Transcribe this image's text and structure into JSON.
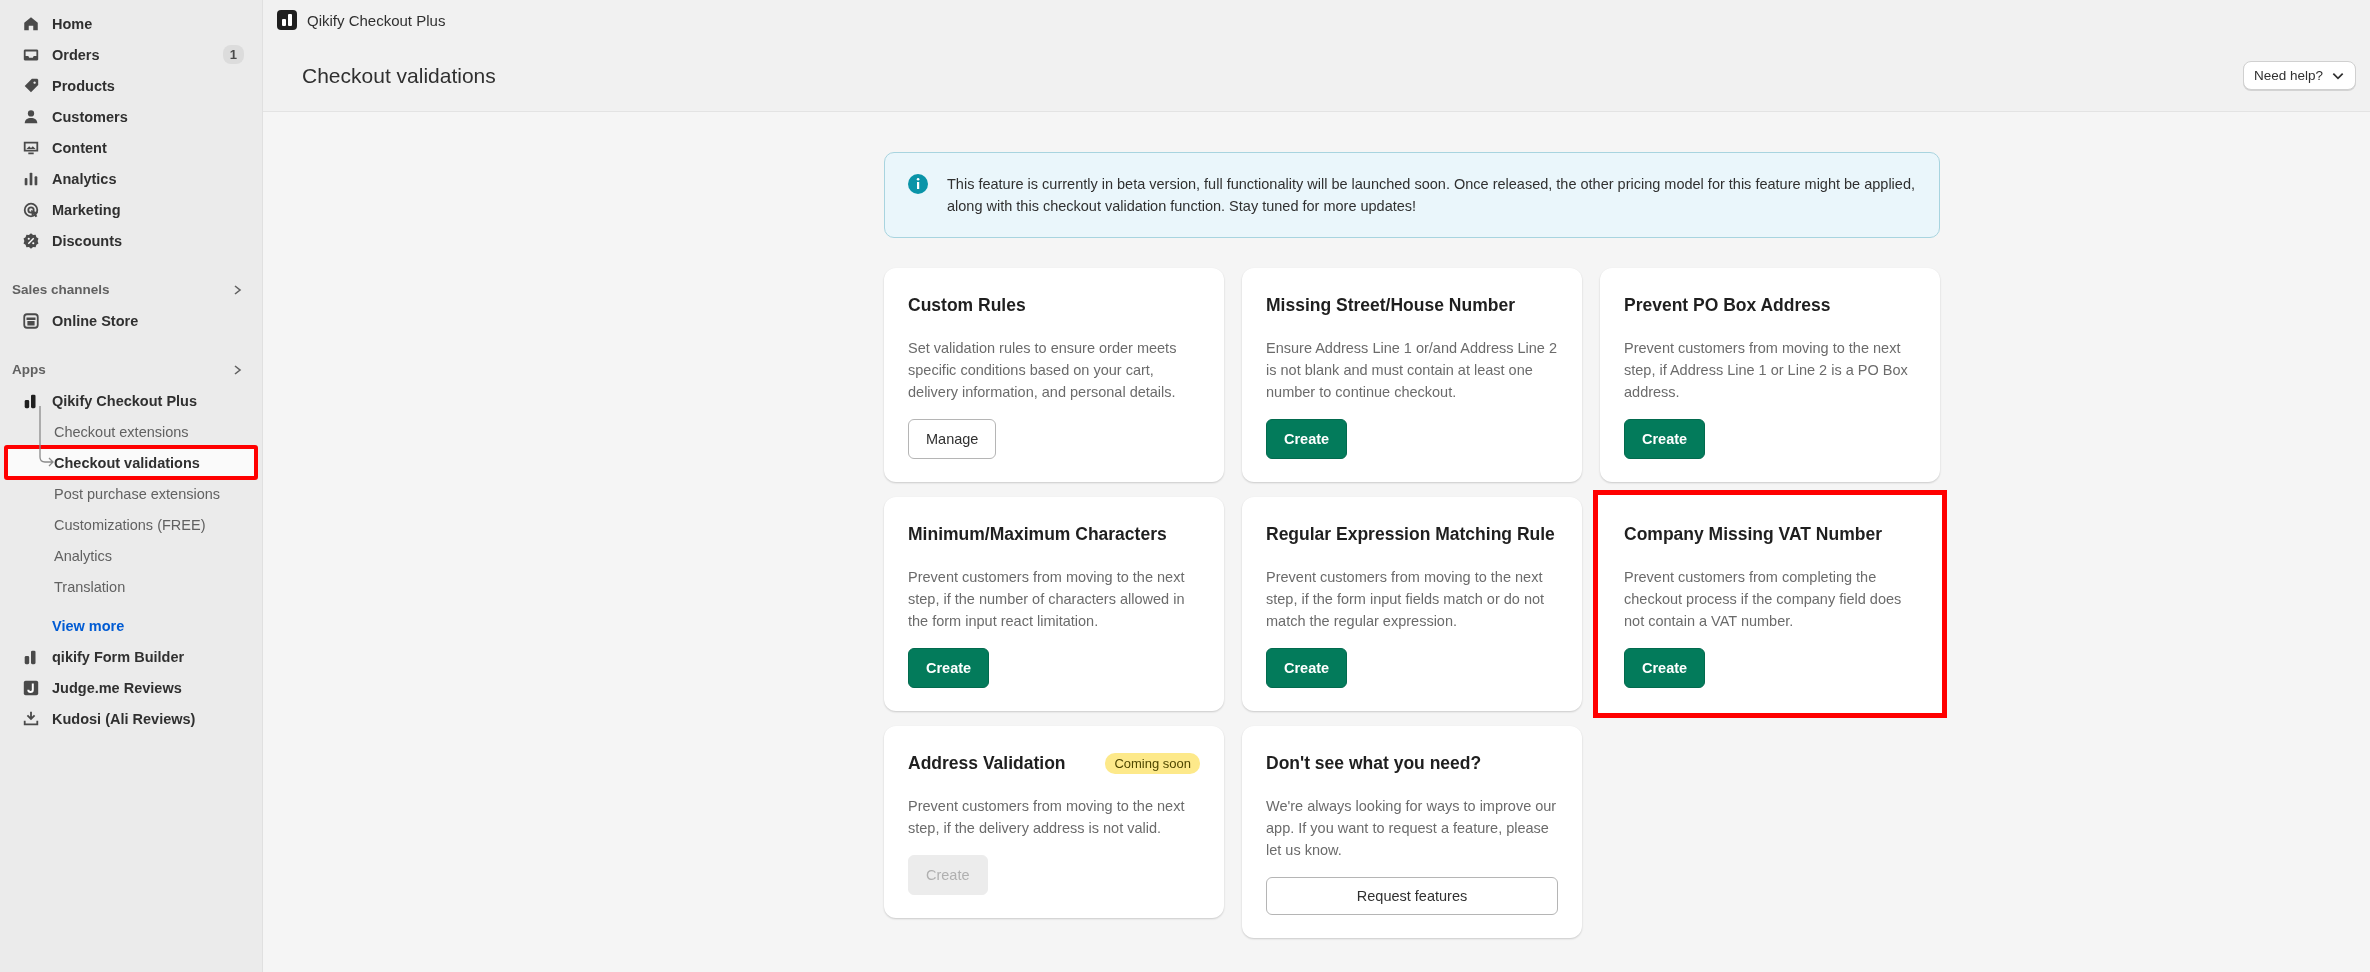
{
  "top_bar": {
    "app_name": "Qikify Checkout Plus"
  },
  "sidebar": {
    "items": [
      {
        "label": "Home"
      },
      {
        "label": "Orders",
        "badge": "1"
      },
      {
        "label": "Products"
      },
      {
        "label": "Customers"
      },
      {
        "label": "Content"
      },
      {
        "label": "Analytics"
      },
      {
        "label": "Marketing"
      },
      {
        "label": "Discounts"
      }
    ],
    "sections": [
      {
        "title": "Sales channels",
        "items": [
          {
            "label": "Online Store"
          }
        ]
      },
      {
        "title": "Apps",
        "items": [
          {
            "label": "Qikify Checkout Plus",
            "children": [
              {
                "label": "Checkout extensions",
                "selected": false,
                "highlighted": false
              },
              {
                "label": "Checkout validations",
                "selected": true,
                "highlighted": true
              },
              {
                "label": "Post purchase extensions",
                "selected": false,
                "highlighted": false
              },
              {
                "label": "Customizations (FREE)",
                "selected": false,
                "highlighted": false
              },
              {
                "label": "Analytics",
                "selected": false,
                "highlighted": false
              },
              {
                "label": "Translation",
                "selected": false,
                "highlighted": false
              }
            ],
            "view_more": "View more"
          },
          {
            "label": "qikify Form Builder"
          },
          {
            "label": "Judge.me Reviews"
          },
          {
            "label": "Kudosi (Ali Reviews)"
          }
        ]
      }
    ]
  },
  "page": {
    "title": "Checkout validations",
    "help_button": "Need help?"
  },
  "banner": {
    "text": "This feature is currently in beta version, full functionality will be launched soon. Once released, the other pricing model for this feature might be applied, along with this checkout validation function. Stay tuned for more updates!"
  },
  "cards": [
    {
      "kind": "rule",
      "title": "Custom Rules",
      "description": "Set validation rules to ensure order meets specific conditions based on your cart, delivery information, and personal details.",
      "button": {
        "label": "Manage",
        "kind": "manage",
        "disabled": false
      },
      "highlighted": false
    },
    {
      "kind": "rule",
      "title": "Missing Street/House Number",
      "description": "Ensure Address Line 1 or/and Address Line 2 is not blank and must contain at least one number to continue checkout.",
      "button": {
        "label": "Create",
        "kind": "create",
        "disabled": false
      },
      "highlighted": false
    },
    {
      "kind": "rule",
      "title": "Prevent PO Box Address",
      "description": "Prevent customers from moving to the next step, if Address Line 1 or Line 2 is a PO Box address.",
      "button": {
        "label": "Create",
        "kind": "create",
        "disabled": false
      },
      "highlighted": false
    },
    {
      "kind": "rule",
      "title": "Minimum/Maximum Characters",
      "description": "Prevent customers from moving to the next step, if the number of characters allowed in the form input react limitation.",
      "button": {
        "label": "Create",
        "kind": "create",
        "disabled": false
      },
      "highlighted": false
    },
    {
      "kind": "rule",
      "title": "Regular Expression Matching Rule",
      "description": "Prevent customers from moving to the next step, if the form input fields match or do not match the regular expression.",
      "button": {
        "label": "Create",
        "kind": "create",
        "disabled": false
      },
      "highlighted": false
    },
    {
      "kind": "rule",
      "title": "Company Missing VAT Number",
      "description": "Prevent customers from completing the checkout process if the company field does not contain a VAT number.",
      "button": {
        "label": "Create",
        "kind": "create",
        "disabled": false
      },
      "highlighted": true
    },
    {
      "kind": "rule",
      "title": "Address Validation",
      "badge": "Coming soon",
      "description": "Prevent customers from moving to the next step, if the delivery address is not valid.",
      "button": {
        "label": "Create",
        "kind": "create",
        "disabled": true
      },
      "highlighted": false
    },
    {
      "kind": "request",
      "title": "Don't see what you need?",
      "description": "We're always looking for ways to improve our app. If you want to request a feature, please let us know.",
      "button": {
        "label": "Request features",
        "kind": "request",
        "disabled": false
      },
      "highlighted": false
    }
  ]
}
